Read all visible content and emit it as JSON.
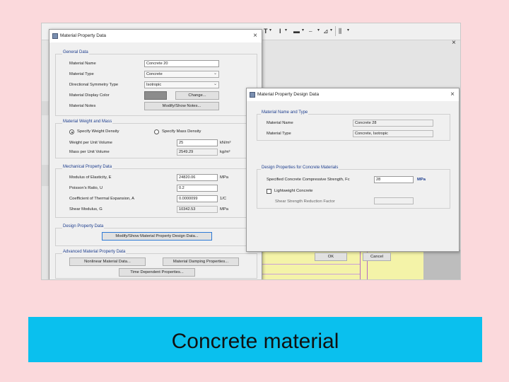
{
  "toolbar": {
    "items": [
      "T",
      "▾",
      "I",
      "▾",
      "▬",
      "▾",
      "⎯",
      "▾",
      "⊿",
      "▾",
      "⫼",
      "▾"
    ],
    "menu_text": "..., ...,  ..  ..."
  },
  "window_close": "×",
  "material_dialog": {
    "title": "Material Property Data",
    "close": "×",
    "general": {
      "heading": "General Data",
      "name_label": "Material Name",
      "name_value": "Concrete 20",
      "type_label": "Material Type",
      "type_value": "Concrete",
      "symmetry_label": "Directional Symmetry Type",
      "symmetry_value": "Isotropic",
      "color_label": "Material Display Color",
      "color_value": "#8c8c8c",
      "change_button": "Change...",
      "notes_label": "Material Notes",
      "notes_button": "Modify/Show Notes..."
    },
    "weight": {
      "heading": "Material Weight and Mass",
      "radio_weight": "Specify Weight Density",
      "radio_mass": "Specify Mass Density",
      "weight_label": "Weight per Unit Volume",
      "weight_value": "25",
      "weight_unit": "kN/m³",
      "mass_label": "Mass per Unit Volume",
      "mass_value": "2549.29",
      "mass_unit": "kg/m³"
    },
    "mechanical": {
      "heading": "Mechanical Property Data",
      "e_label": "Modulus of Elasticity,  E",
      "e_value": "24820.06",
      "e_unit": "MPa",
      "u_label": "Poisson's Ratio,  U",
      "u_value": "0.2",
      "a_label": "Coefficient of Thermal Expansion,  A",
      "a_value": "0.0000099",
      "a_unit": "1/C",
      "g_label": "Shear Modulus,  G",
      "g_value": "10342.53",
      "g_unit": "MPa"
    },
    "design": {
      "heading": "Design Property Data",
      "button": "Modify/Show Material Property Design Data..."
    },
    "advanced": {
      "heading": "Advanced Material Property Data",
      "nonlinear_button": "Nonlinear Material Data...",
      "damping_button": "Material Damping Properties...",
      "time_button": "Time Dependent Properties..."
    }
  },
  "design_dialog": {
    "title": "Material Property Design Data",
    "close": "×",
    "name_type": {
      "heading": "Material Name and Type",
      "name_label": "Material Name",
      "name_value": "Concrete 28",
      "type_label": "Material Type",
      "type_value": "Concrete, Isotropic"
    },
    "design_props": {
      "heading": "Design Properties for Concrete Materials",
      "fc_label": "Specified Concrete Compressive Strength, Fc",
      "fc_value": "28",
      "fc_unit": "MPa",
      "lightweight_label": "Lightweight Concrete",
      "shear_label": "Shear Strength Reduction Factor"
    },
    "ok_button": "OK",
    "cancel_button": "Cancel"
  },
  "caption": "Concrete material"
}
